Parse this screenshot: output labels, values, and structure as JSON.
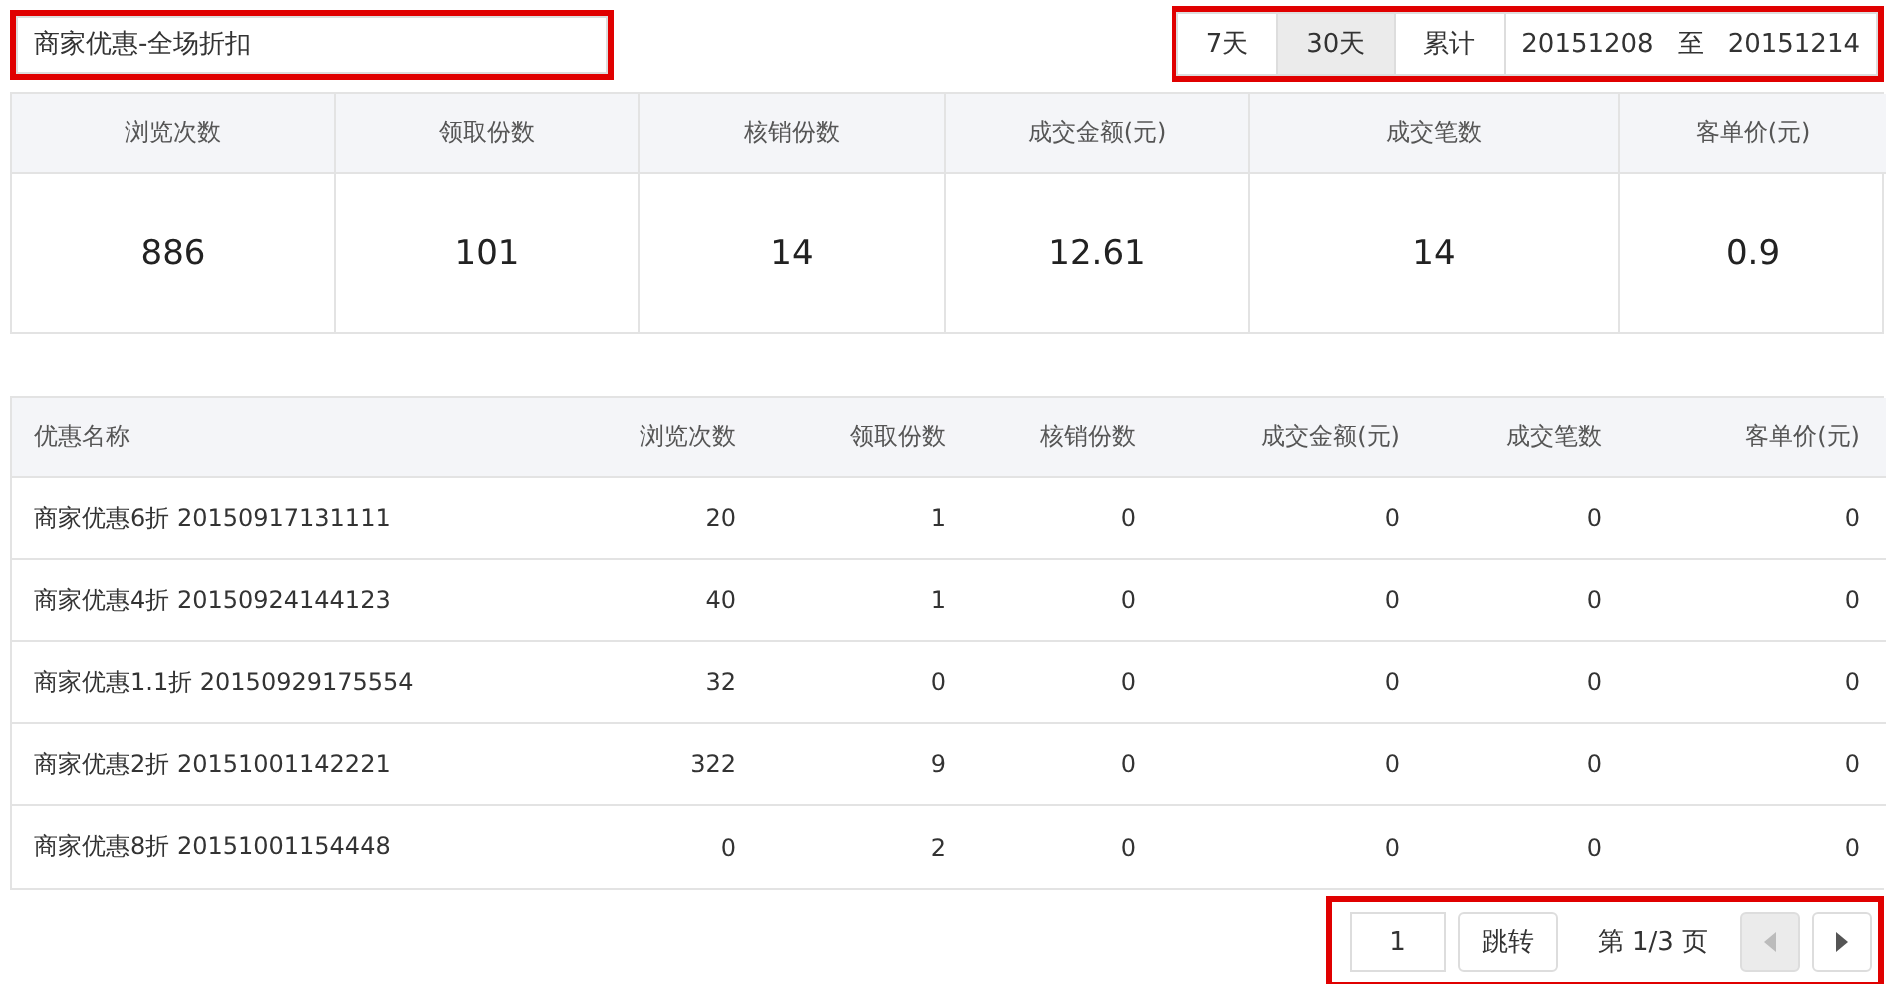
{
  "title_field": {
    "value": "商家优惠-全场折扣",
    "highlighted": true
  },
  "period": {
    "highlighted": true,
    "options": [
      {
        "label": "7天",
        "selected": false
      },
      {
        "label": "30天",
        "selected": true
      },
      {
        "label": "累计",
        "selected": false
      }
    ],
    "date_from": "20151208",
    "date_sep": "至",
    "date_to": "20151214"
  },
  "summary": {
    "columns": [
      "浏览次数",
      "领取份数",
      "核销份数",
      "成交金额(元)",
      "成交笔数",
      "客单价(元)"
    ],
    "values": [
      "886",
      "101",
      "14",
      "12.61",
      "14",
      "0.9"
    ]
  },
  "table": {
    "columns": [
      "优惠名称",
      "浏览次数",
      "领取份数",
      "核销份数",
      "成交金额(元)",
      "成交笔数",
      "客单价(元)"
    ],
    "rows": [
      [
        "商家优惠6折 20150917131111",
        "20",
        "1",
        "0",
        "0",
        "0",
        "0"
      ],
      [
        "商家优惠4折 20150924144123",
        "40",
        "1",
        "0",
        "0",
        "0",
        "0"
      ],
      [
        "商家优惠1.1折 20150929175554",
        "32",
        "0",
        "0",
        "0",
        "0",
        "0"
      ],
      [
        "商家优惠2折 20151001142221",
        "322",
        "9",
        "0",
        "0",
        "0",
        "0"
      ],
      [
        "商家优惠8折 20151001154448",
        "0",
        "2",
        "0",
        "0",
        "0",
        "0"
      ]
    ]
  },
  "pagination": {
    "highlighted": true,
    "page_input": "1",
    "jump": "跳转",
    "page_info": "第 1/3 页",
    "prev_disabled": true,
    "next_disabled": false
  }
}
